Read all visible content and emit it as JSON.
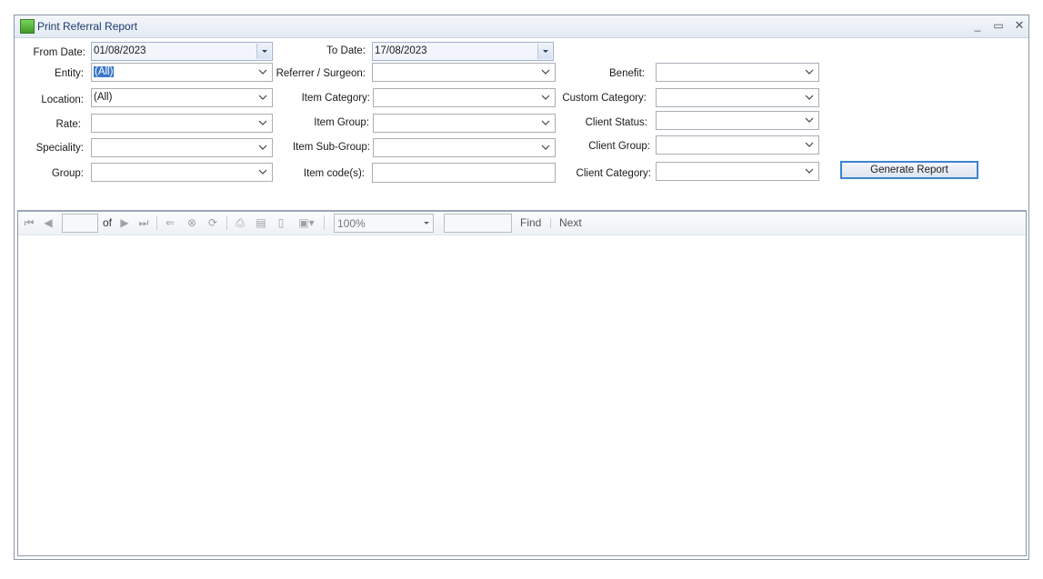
{
  "window": {
    "title": "Print Referral Report",
    "controls": {
      "minimize": "_",
      "maximize": "▭",
      "close": "✕"
    }
  },
  "form": {
    "from_date": {
      "label": "From Date:",
      "value": "01/08/2023"
    },
    "to_date": {
      "label": "To Date:",
      "value": "17/08/2023"
    },
    "entity": {
      "label": "Entity:",
      "value": "(All)"
    },
    "location": {
      "label": "Location:",
      "value": "(All)"
    },
    "rate": {
      "label": "Rate:",
      "value": ""
    },
    "speciality": {
      "label": "Speciality:",
      "value": ""
    },
    "group": {
      "label": "Group:",
      "value": ""
    },
    "referrer": {
      "label": "Referrer / Surgeon:",
      "value": ""
    },
    "item_category": {
      "label": "Item Category:",
      "value": ""
    },
    "item_group": {
      "label": "Item Group:",
      "value": ""
    },
    "item_sub_group": {
      "label": "Item Sub-Group:",
      "value": ""
    },
    "item_codes": {
      "label": "Item code(s):",
      "value": ""
    },
    "benefit": {
      "label": "Benefit:",
      "value": ""
    },
    "custom_category": {
      "label": "Custom Category:",
      "value": ""
    },
    "client_status": {
      "label": "Client Status:",
      "value": ""
    },
    "client_group": {
      "label": "Client Group:",
      "value": ""
    },
    "client_category": {
      "label": "Client Category:",
      "value": ""
    },
    "generate_button": "Generate Report"
  },
  "viewer": {
    "page_current": "",
    "of_label": "of",
    "zoom": "100%",
    "find_text": "",
    "find_label": "Find",
    "next_label": "Next"
  }
}
